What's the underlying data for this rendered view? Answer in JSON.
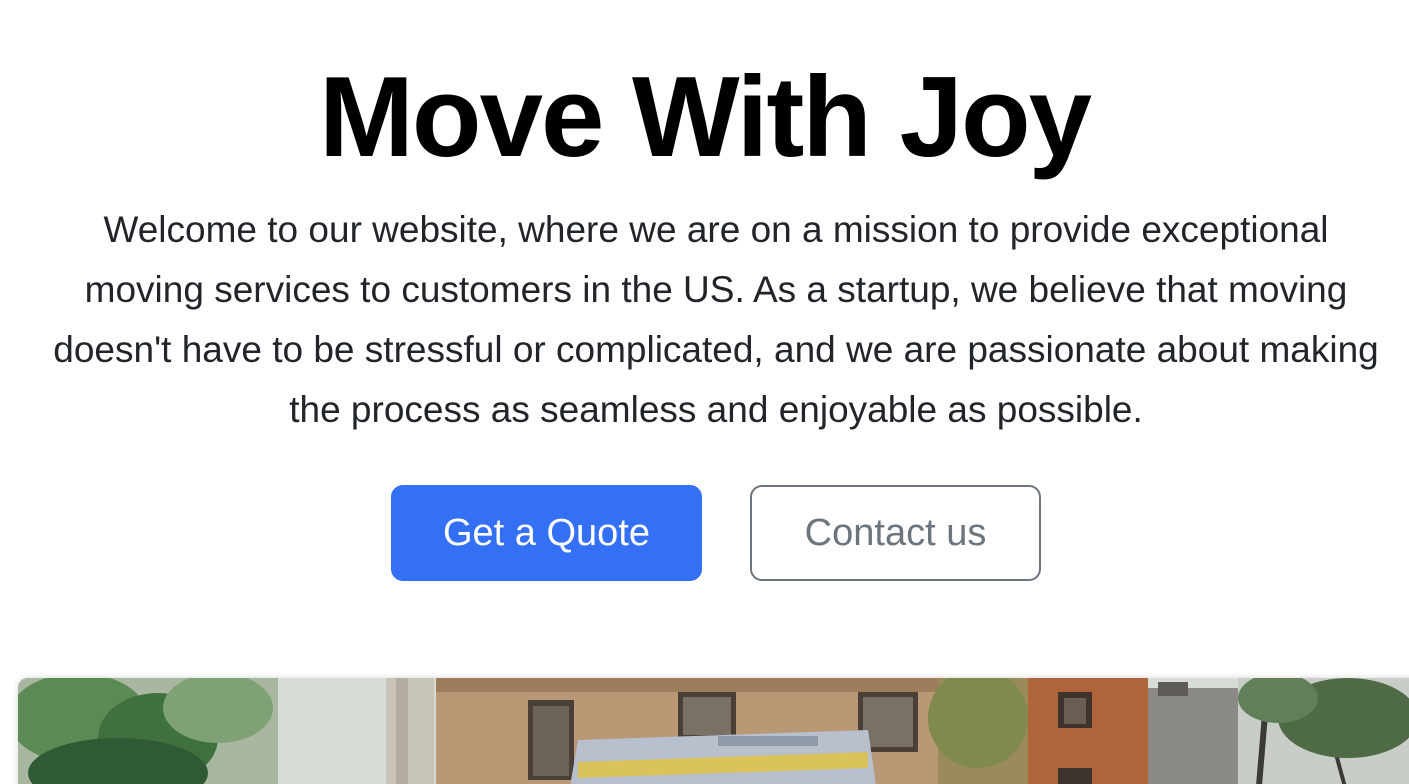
{
  "hero": {
    "title": "Move With Joy",
    "lead": "Welcome to our website, where we are on a mission to provide exceptional moving services to customers in the US. As a startup, we believe that moving doesn't have to be stressful or complicated, and we are passionate about making the process as seamless and enjoyable as possible.",
    "primary_button": "Get a Quote",
    "secondary_button": "Contact us"
  },
  "colors": {
    "primary": "#3370f5",
    "outline": "#6c757d",
    "title": "#000000",
    "text": "#212529"
  }
}
